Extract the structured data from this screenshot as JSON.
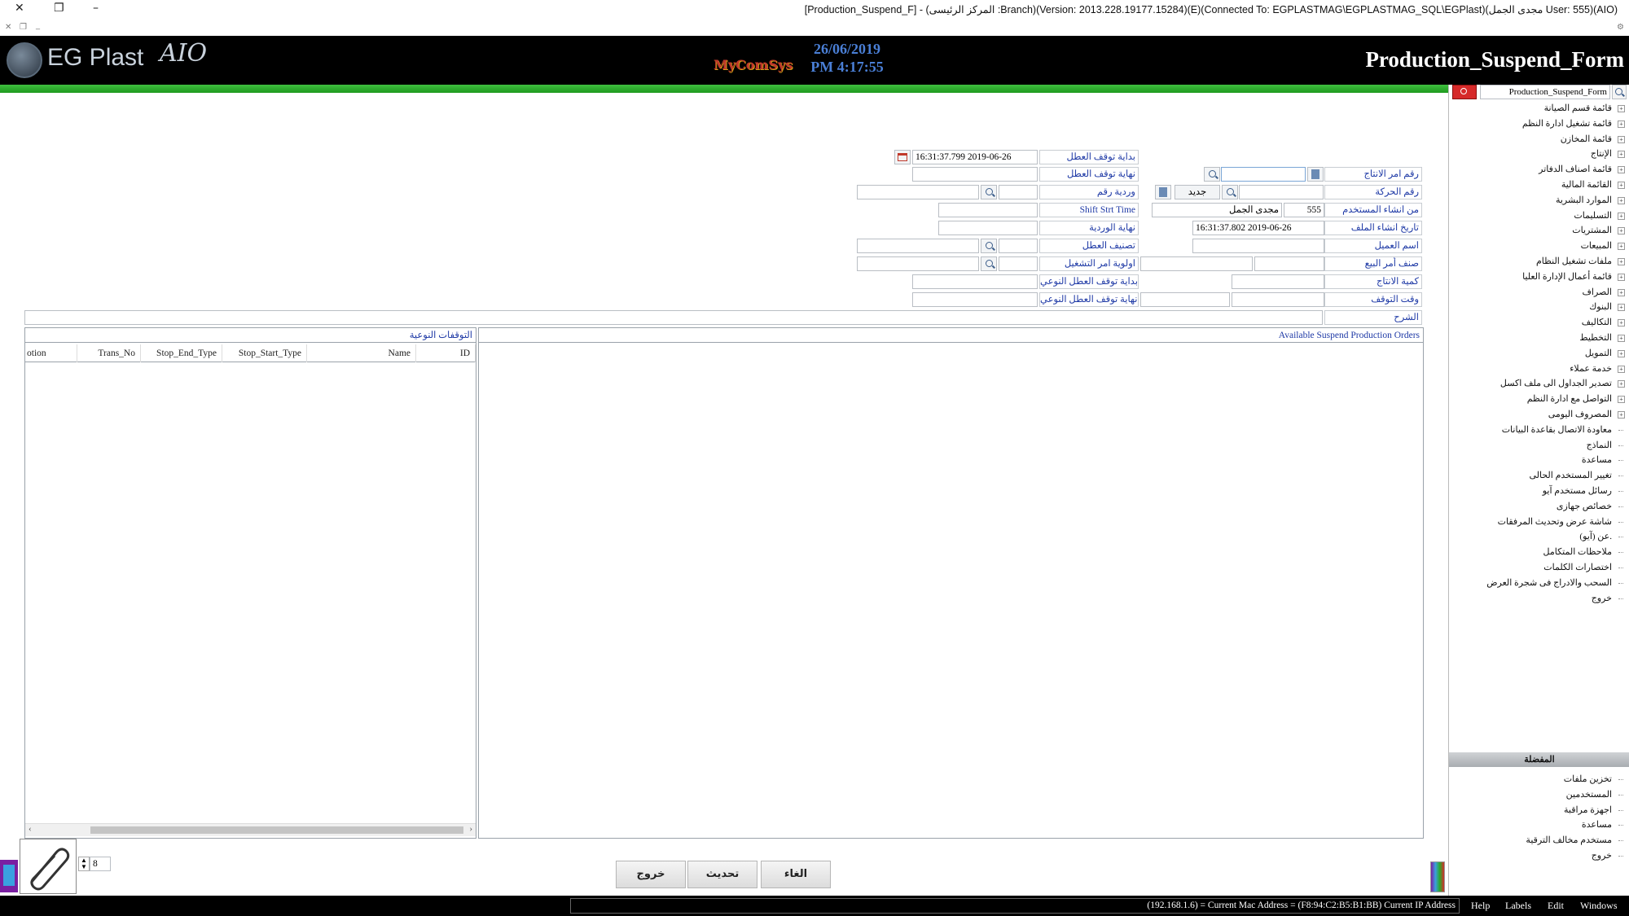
{
  "window": {
    "title": "[Production_Suspend_F] - (المركز الرئيسى :Branch)(Version: 2013.228.19177.15284)(E)(Connected To: EGPLASTMAG\\EGPLASTMAG_SQL\\EGPlast)(مجدى الجمل User: 555)(AIO)"
  },
  "header": {
    "logo_text": "EG Plast",
    "logo_suffix": "AIO",
    "brand_badge": "MyComSys",
    "date": "26/06/2019",
    "time": "PM 4:17:55",
    "form_title": "Production_Suspend_Form"
  },
  "form": {
    "right_labels": {
      "prod_order_no": "رقم امر الانتاج",
      "trans_no": "رقم الحركة",
      "created_by": "من انشاء المستخدم",
      "created_at": "تاريخ انشاء الملف",
      "customer_name": "اسم العميل",
      "sales_order_item": "صنف أمر البيع",
      "prod_qty": "كمية الانتاج",
      "stop_time": "وقت التوقف",
      "notes": "الشرح"
    },
    "right_values": {
      "new_button": "جديد",
      "user_code": "555",
      "user_name": "مجدى الجمل",
      "created_at": "16:31:37.802 2019-06-26"
    },
    "middle_labels": {
      "stop_start": "بداية توقف العطل",
      "stop_end": "نهاية توقف العطل",
      "shift_no": "وردية رقم",
      "shift_start_time": "Shift Strt Time",
      "shift_end": "نهاية الوردية",
      "fault_class": "تصنيف العطل",
      "job_priority": "اولوية امر التشغيل",
      "qualitative_stop_start": "بداية توقف العطل النوعي",
      "qualitative_stop_end": "نهاية توقف العطل النوعي"
    },
    "middle_values": {
      "stop_start": "16:31:37.799 2019-06-26"
    }
  },
  "grids": {
    "left_title": "التوقفات النوعية",
    "left_columns": [
      "ID",
      "Name",
      "Stop_Start_Type",
      "Stop_End_Type",
      "Trans_No",
      "otion"
    ],
    "right_title": "Available Suspend Production Orders"
  },
  "footer": {
    "page_value": "8",
    "buttons": {
      "cancel": "الغاء",
      "refresh": "تحديث",
      "exit": "خروج"
    }
  },
  "sidebar": {
    "search_value": "Production_Suspend_Form",
    "tree": [
      {
        "label": "قائمة قسم الصيانة",
        "expandable": true
      },
      {
        "label": "قائمة تشغيل ادارة النظم",
        "expandable": true
      },
      {
        "label": "قائمة المخازن",
        "expandable": true
      },
      {
        "label": "الإنتاج",
        "expandable": true
      },
      {
        "label": "قائمة اصناف الدفاتر",
        "expandable": true
      },
      {
        "label": "القائمة المالية",
        "expandable": true
      },
      {
        "label": "الموارد البشرية",
        "expandable": true
      },
      {
        "label": "التسليمات",
        "expandable": true
      },
      {
        "label": "المشتريات",
        "expandable": true
      },
      {
        "label": "المبيعات",
        "expandable": true
      },
      {
        "label": "ملفات تشغيل النظام",
        "expandable": true
      },
      {
        "label": "قائمة أعمال الإدارة العليا",
        "expandable": true
      },
      {
        "label": "الصراف",
        "expandable": true
      },
      {
        "label": "البنوك",
        "expandable": true
      },
      {
        "label": "التكاليف",
        "expandable": true
      },
      {
        "label": "التخطيط",
        "expandable": true
      },
      {
        "label": "التمويل",
        "expandable": true
      },
      {
        "label": "خدمة عملاء",
        "expandable": true
      },
      {
        "label": "تصدير الجداول الى ملف اكسل",
        "expandable": true
      },
      {
        "label": "التواصل مع ادارة النظم",
        "expandable": true
      },
      {
        "label": "المصروف اليومى",
        "expandable": true
      },
      {
        "label": "معاودة الاتصال بقاعدة البيانات",
        "expandable": false
      },
      {
        "label": "النماذج",
        "expandable": false
      },
      {
        "label": "مساعدة",
        "expandable": false
      },
      {
        "label": "تغيير المستخدم الحالى",
        "expandable": false
      },
      {
        "label": "رسائل مستخدم آيو",
        "expandable": false
      },
      {
        "label": "خصائص جهازى",
        "expandable": false
      },
      {
        "label": "شاشة عرض وتحديث المرفقات",
        "expandable": false
      },
      {
        "label": "عن (آيو).",
        "expandable": false
      },
      {
        "label": "ملاحظات المتكامل",
        "expandable": false
      },
      {
        "label": "اختصارات الكلمات",
        "expandable": false
      },
      {
        "label": "السحب والادراج فى شجرة العرض",
        "expandable": false
      },
      {
        "label": "خروج",
        "expandable": false
      }
    ],
    "favorites_title": "المفضلة",
    "favorites": [
      "تخزين ملفات",
      "المستخدمين",
      "اجهزة مراقبة",
      "مساعدة",
      "مستخدم مخالف الترقية",
      "خروج"
    ]
  },
  "statusbar": {
    "info": "(192.168.1.6) = Current Mac Address = (F8:94:C2:B5:B1:BB) Current IP Address",
    "menu": [
      "Help",
      "Labels",
      "Edit",
      "Windows"
    ]
  },
  "colors": {
    "header_bg": "#000000",
    "green_bar": "#2aaa2a",
    "label_text": "#1f3aa6",
    "date_text": "#4a7fd6",
    "search_red": "#d62a2a"
  }
}
